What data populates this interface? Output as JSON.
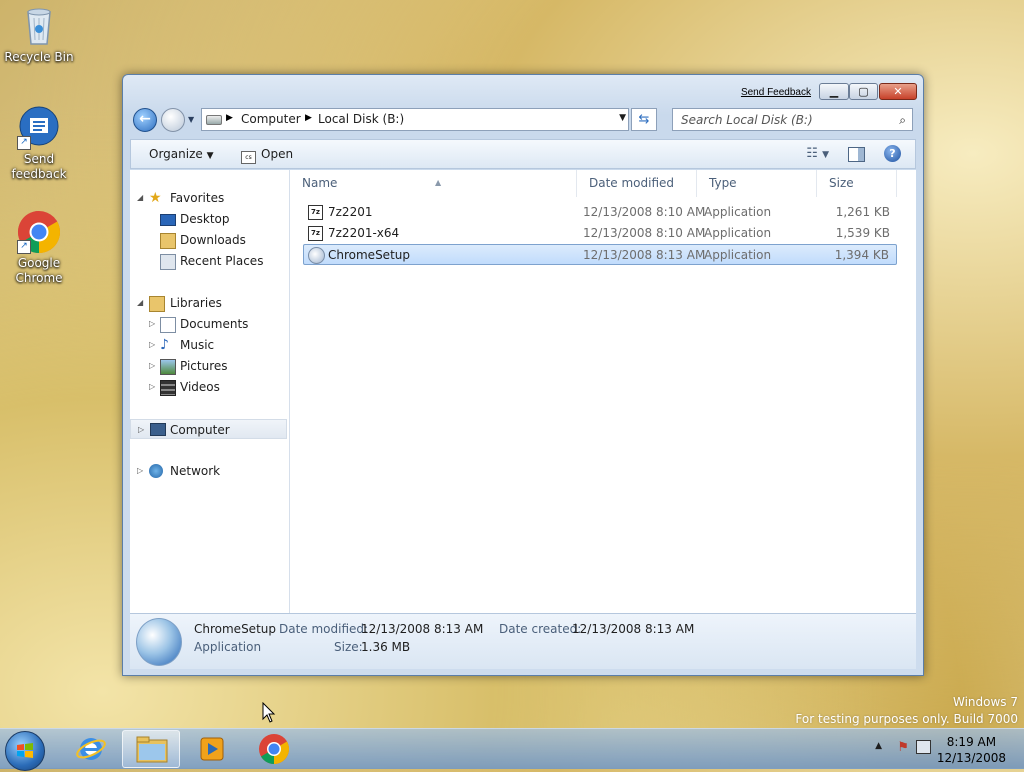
{
  "desktop": {
    "icons": [
      {
        "label": "Recycle Bin"
      },
      {
        "label": "Send feedback"
      },
      {
        "label": "Google Chrome"
      }
    ],
    "watermark": {
      "line1": "Windows 7",
      "line2": "For testing purposes only. Build 7000"
    }
  },
  "window": {
    "send_feedback": "Send Feedback",
    "address": {
      "crumb1": "Computer",
      "crumb2": "Local Disk (B:)"
    },
    "search": {
      "placeholder": "Search Local Disk (B:)"
    },
    "toolbar": {
      "organize": "Organize",
      "open": "Open"
    },
    "nav": {
      "favorites": "Favorites",
      "desktop": "Desktop",
      "downloads": "Downloads",
      "recent_places": "Recent Places",
      "libraries": "Libraries",
      "documents": "Documents",
      "music": "Music",
      "pictures": "Pictures",
      "videos": "Videos",
      "computer": "Computer",
      "network": "Network"
    },
    "columns": {
      "name": "Name",
      "date_modified": "Date modified",
      "type": "Type",
      "size": "Size"
    },
    "files": [
      {
        "name": "7z2201",
        "date": "12/13/2008 8:10 AM",
        "type": "Application",
        "size": "1,261 KB",
        "selected": false
      },
      {
        "name": "7z2201-x64",
        "date": "12/13/2008 8:10 AM",
        "type": "Application",
        "size": "1,539 KB",
        "selected": false
      },
      {
        "name": "ChromeSetup",
        "date": "12/13/2008 8:13 AM",
        "type": "Application",
        "size": "1,394 KB",
        "selected": true
      }
    ],
    "details": {
      "name": "ChromeSetup",
      "type": "Application",
      "modified_label": "Date modified:",
      "modified_value": "12/13/2008 8:13 AM",
      "created_label": "Date created:",
      "created_value": "12/13/2008 8:13 AM",
      "size_label": "Size:",
      "size_value": "1.36 MB"
    }
  },
  "taskbar": {
    "time": "8:19 AM",
    "date": "12/13/2008"
  },
  "colors": {
    "accent": "#2f6fc0",
    "selection": "#c1dcfc"
  }
}
